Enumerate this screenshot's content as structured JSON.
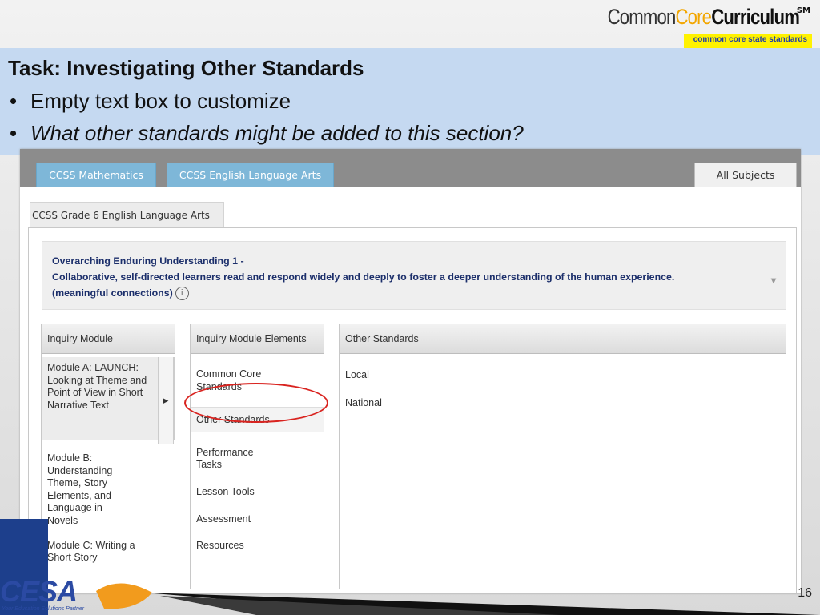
{
  "logo": {
    "part1": "Common",
    "part2": "Core",
    "part3": "Curriculum",
    "mark": "SM",
    "tagline": "common core state standards"
  },
  "slide": {
    "title": "Task:  Investigating Other Standards",
    "bullet1": "Empty text box to customize",
    "bullet2": "What other standards might be added to this section?",
    "page_number": "16",
    "footer_logo": "CESA",
    "footer_logo_sub": "Your Education Solutions Partner"
  },
  "tabs": {
    "math": "CCSS Mathematics",
    "ela": "CCSS English Language Arts",
    "all": "All Subjects"
  },
  "grade_tab": "CCSS Grade 6 English Language Arts",
  "understanding": {
    "heading": "Overarching Enduring Understanding 1 -",
    "body": "Collaborative, self-directed learners read and respond widely and deeply to foster a deeper understanding of the human experience.",
    "tag": "(meaningful connections)"
  },
  "columns": {
    "module": {
      "header": "Inquiry Module",
      "items": [
        "Module A: LAUNCH:  Looking at Theme and Point of View in Short Narrative Text",
        "Module B: Understanding Theme, Story Elements, and Language in Novels",
        "Module C: Writing a Short Story"
      ]
    },
    "elements": {
      "header": "Inquiry Module Elements",
      "items": [
        "Common Core Standards",
        "Other Standards",
        "Performance Tasks",
        "Lesson Tools",
        "Assessment",
        "Resources"
      ]
    },
    "other": {
      "header": "Other Standards",
      "items": [
        "Local",
        "National"
      ]
    }
  },
  "colors": {
    "banner": "#c5d9f1",
    "tab_blue": "#7eb7d8",
    "heading_blue": "#1c2f6b",
    "highlight_circle": "#d9231f"
  }
}
